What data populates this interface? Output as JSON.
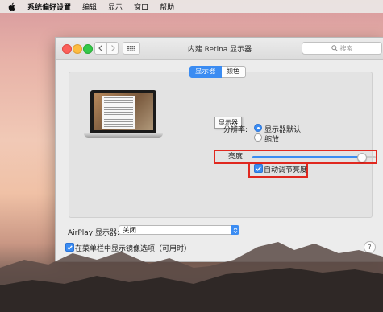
{
  "menubar": {
    "app_name": "系统偏好设置",
    "items": [
      "编辑",
      "显示",
      "窗口",
      "帮助"
    ]
  },
  "window": {
    "title": "内建 Retina 显示器",
    "search_placeholder": "搜索"
  },
  "tabs": [
    {
      "label": "显示器",
      "active": true
    },
    {
      "label": "颜色",
      "active": false
    }
  ],
  "tooltip": "显示器",
  "resolution": {
    "label": "分辨率:",
    "options": [
      {
        "label": "显示器默认",
        "selected": true
      },
      {
        "label": "缩放",
        "selected": false
      }
    ]
  },
  "brightness": {
    "label": "亮度:",
    "level": 0.88,
    "auto_label": "自动调节亮度",
    "auto_checked": true
  },
  "airplay": {
    "label": "AirPlay 显示器:",
    "value": "关闭"
  },
  "mirror_option": {
    "label": "在菜单栏中显示镜像选项（可用时）",
    "checked": true
  },
  "help_label": "?",
  "colors": {
    "accent": "#3b8cf2",
    "highlight": "#e0281f"
  }
}
